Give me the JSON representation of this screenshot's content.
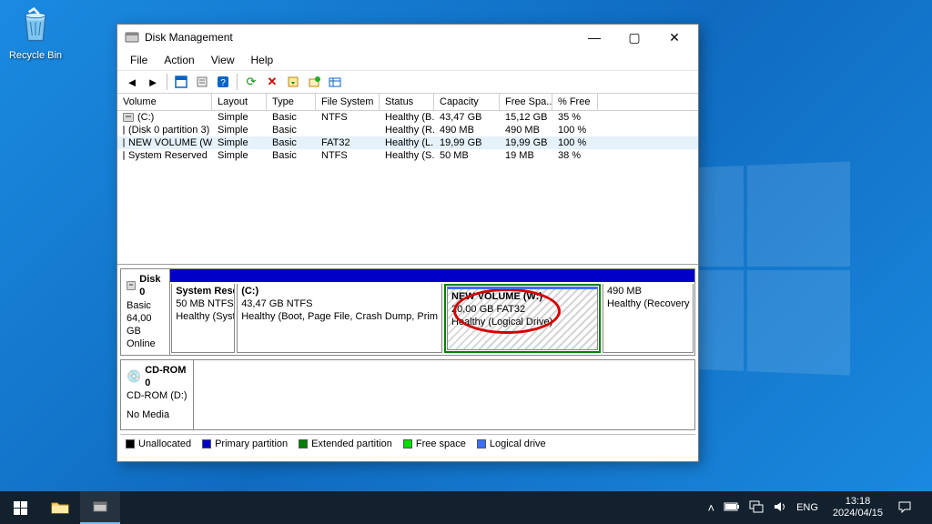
{
  "desktop": {
    "recycle_bin": "Recycle Bin"
  },
  "window": {
    "title": "Disk Management",
    "menu": {
      "file": "File",
      "action": "Action",
      "view": "View",
      "help": "Help"
    }
  },
  "table": {
    "headers": {
      "volume": "Volume",
      "layout": "Layout",
      "type": "Type",
      "fs": "File System",
      "status": "Status",
      "capacity": "Capacity",
      "free": "Free Spa...",
      "pct": "% Free"
    },
    "rows": [
      {
        "volume": "(C:)",
        "layout": "Simple",
        "type": "Basic",
        "fs": "NTFS",
        "status": "Healthy (B...",
        "capacity": "43,47 GB",
        "free": "15,12 GB",
        "pct": "35 %"
      },
      {
        "volume": "(Disk 0 partition 3)",
        "layout": "Simple",
        "type": "Basic",
        "fs": "",
        "status": "Healthy (R...",
        "capacity": "490 MB",
        "free": "490 MB",
        "pct": "100 %"
      },
      {
        "volume": "NEW VOLUME (W:)",
        "layout": "Simple",
        "type": "Basic",
        "fs": "FAT32",
        "status": "Healthy (L...",
        "capacity": "19,99 GB",
        "free": "19,99 GB",
        "pct": "100 %"
      },
      {
        "volume": "System Reserved",
        "layout": "Simple",
        "type": "Basic",
        "fs": "NTFS",
        "status": "Healthy (S...",
        "capacity": "50 MB",
        "free": "19 MB",
        "pct": "38 %"
      }
    ]
  },
  "disk0": {
    "name": "Disk 0",
    "type": "Basic",
    "size": "64,00 GB",
    "status": "Online",
    "parts": {
      "sysres": {
        "name": "System Rese",
        "sub": "50 MB NTFS",
        "stat": "Healthy (Syst"
      },
      "c": {
        "name": "(C:)",
        "sub": "43,47 GB NTFS",
        "stat": "Healthy (Boot, Page File, Crash Dump, Prim"
      },
      "w": {
        "name": "NEW VOLUME (W:)",
        "sub": "20,00 GB FAT32",
        "stat": "Healthy (Logical Drive)"
      },
      "recov": {
        "name": "",
        "sub": "490 MB",
        "stat": "Healthy (Recovery Parti"
      }
    }
  },
  "cdrom": {
    "name": "CD-ROM 0",
    "drive": "CD-ROM (D:)",
    "status": "No Media"
  },
  "legend": {
    "unalloc": "Unallocated",
    "primary": "Primary partition",
    "ext": "Extended partition",
    "free": "Free space",
    "logical": "Logical drive"
  },
  "taskbar": {
    "lang": "ENG",
    "time": "13:18",
    "date": "2024/04/15"
  }
}
